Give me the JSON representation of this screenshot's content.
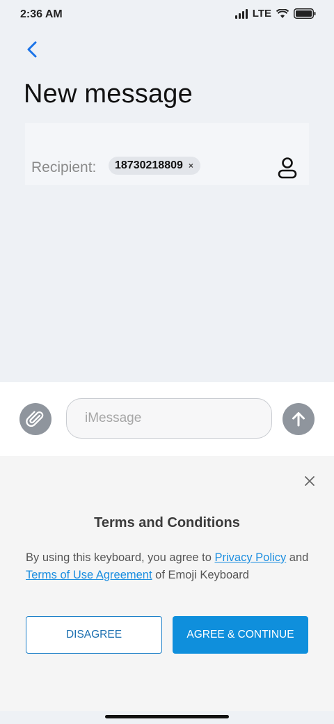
{
  "status_bar": {
    "time": "2:36 AM",
    "network": "LTE",
    "icons": [
      "signal-icon",
      "wifi-icon",
      "battery-icon"
    ]
  },
  "header": {
    "back_icon": "chevron-left-icon",
    "title": "New message"
  },
  "recipient": {
    "label": "Recipient:",
    "chip_value": "18730218809",
    "chip_remove": "×",
    "contact_icon": "person-icon"
  },
  "compose": {
    "attach_icon": "paperclip-icon",
    "placeholder": "iMessage",
    "value": "",
    "send_icon": "arrow-up-icon"
  },
  "terms": {
    "close_icon": "close-icon",
    "title": "Terms and Conditions",
    "text_before": "By using this keyboard, you agree to ",
    "privacy_link": "Privacy Policy",
    "text_and": " and ",
    "terms_link": "Terms of Use Agreement",
    "text_after": " of Emoji Keyboard",
    "disagree_label": "DISAGREE",
    "agree_label": "AGREE & CONTINUE"
  },
  "colors": {
    "accent": "#0f8fdc",
    "link": "#1b8ee0",
    "background": "#eef1f5",
    "icon_button": "#8f959d"
  }
}
